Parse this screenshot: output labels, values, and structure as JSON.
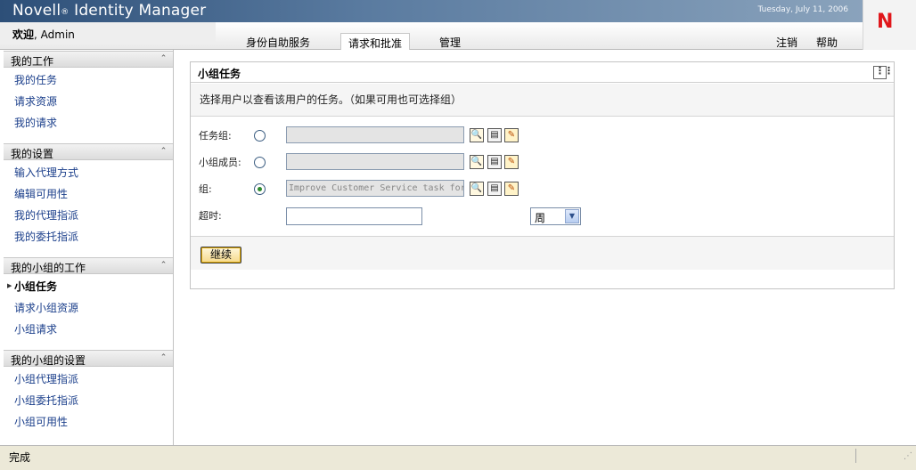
{
  "banner": {
    "brand_left": "Novell",
    "brand_mark": "®",
    "brand_right": " Identity Manager",
    "date": "Tuesday, July 11, 2006",
    "logo_letter": "N"
  },
  "topbar": {
    "welcome_label": "欢迎",
    "welcome_user": ", Admin",
    "tabs": [
      "身份自助服务",
      "请求和批准",
      "管理"
    ],
    "active_tab": "请求和批准",
    "logout": "注销",
    "help": "帮助"
  },
  "sidebar": {
    "sections": [
      {
        "title": "我的工作",
        "items": [
          "我的任务",
          "请求资源",
          "我的请求"
        ]
      },
      {
        "title": "我的设置",
        "items": [
          "输入代理方式",
          "编辑可用性",
          "我的代理指派",
          "我的委托指派"
        ]
      },
      {
        "title": "我的小组的工作",
        "items": [
          "小组任务",
          "请求小组资源",
          "小组请求"
        ]
      },
      {
        "title": "我的小组的设置",
        "items": [
          "小组代理指派",
          "小组委托指派",
          "小组可用性"
        ]
      }
    ],
    "current_item": "小组任务"
  },
  "panel": {
    "title": "小组任务",
    "description": "选择用户以查看该用户的任务。（如果可用也可选择组）",
    "fields": [
      {
        "label": "任务组:",
        "selected": false,
        "value": ""
      },
      {
        "label": "小组成员:",
        "selected": false,
        "value": ""
      },
      {
        "label": "组:",
        "selected": true,
        "value": "Improve Customer Service task force"
      }
    ],
    "timeout_label": "超时:",
    "timeout_value": "",
    "timeout_unit": "周",
    "continue_label": "继续"
  },
  "statusbar": {
    "text": "完成"
  },
  "colors": {
    "banner": "#2d4f78",
    "link": "#1b3f8b",
    "logo_red": "#e0161a",
    "button": "#f6d98a"
  }
}
